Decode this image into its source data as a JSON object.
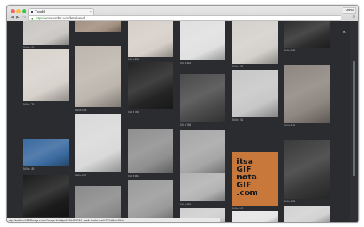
{
  "browser": {
    "tab_title": "Tumblr",
    "tab_close": "×",
    "user_label": "Mario",
    "back": "◀",
    "forward": "▶",
    "reload": "↻",
    "lock_icon": "lock-icon",
    "url_scheme": "https://",
    "url_rest": "www.tumblr.com/dashboard",
    "menu_icon": "≡"
  },
  "page": {
    "close_glyph": "×",
    "status_url": "http://localhost:8888/image-search?imageUrl=https%3A%2F%2F41.media.tumblr.com%2F7b09bc1f4b0c..."
  },
  "grid": [
    {
      "items": [
        {
          "caption": "540 x 810",
          "tone": "#c9c6c3"
        },
        {
          "caption": "540 x 770",
          "tone": "#d8d2cc"
        },
        {
          "caption": "540 x 185",
          "tone": "#3a6aa0"
        },
        {
          "caption": "540 x 540",
          "tone": "#1c1c1c"
        }
      ]
    },
    {
      "items": [
        {
          "caption": "",
          "tone": "#a29080"
        },
        {
          "caption": "540 x 788",
          "tone": "#bdb6ae"
        },
        {
          "caption": "540 x 877",
          "tone": "#d9d9d9"
        },
        {
          "caption": "",
          "tone": "#8a8a8a"
        }
      ]
    },
    {
      "items": [
        {
          "caption": "540 x 869",
          "tone": "#d6cfc8"
        },
        {
          "caption": "540 x 789",
          "tone": "#242424"
        },
        {
          "caption": "540 x 540",
          "tone": "#8f8f8f"
        },
        {
          "caption": "",
          "tone": "#9a9a9a"
        }
      ]
    },
    {
      "items": [
        {
          "caption": "540 x 463",
          "tone": "#e0e0e0"
        },
        {
          "caption": "540 x 756",
          "tone": "#4a4a4a"
        },
        {
          "caption": "540 x 800",
          "tone": "#a6a6a6"
        },
        {
          "caption": "540 x 540",
          "tone": "#b2b2b2"
        },
        {
          "caption": "",
          "tone": "#cfcfcf"
        }
      ]
    },
    {
      "items": [
        {
          "caption": "540 x 794",
          "tone": "#d4d0cb"
        },
        {
          "caption": "540 x 761",
          "tone": "#c7c7c7"
        },
        {
          "caption": "540 x 540",
          "tone": "#c8783a",
          "gif": [
            "itsa",
            "GIF",
            "nota",
            "GIF",
            ".com"
          ]
        },
        {
          "caption": "",
          "tone": "#e6e6e6"
        }
      ]
    },
    {
      "items": [
        {
          "caption": "540 x 360",
          "tone": "#2e2e2e"
        },
        {
          "caption": "540 x 834",
          "tone": "#8e8680"
        },
        {
          "caption": "540 x 801",
          "tone": "#3a3a3a"
        },
        {
          "caption": "",
          "tone": "#d2d2d2"
        }
      ]
    }
  ]
}
